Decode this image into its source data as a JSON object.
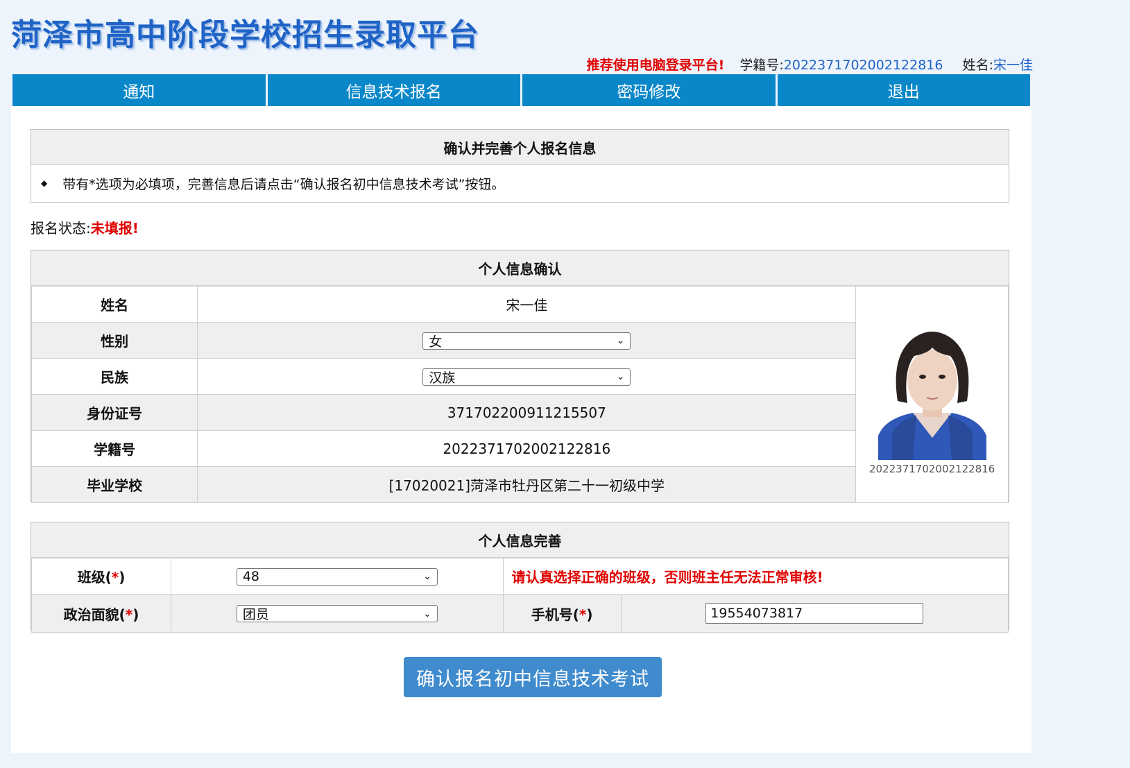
{
  "site_title": "菏泽市高中阶段学校招生录取平台",
  "user_bar": {
    "warning": "推荐使用电脑登录平台!",
    "student_id_label": "学籍号:",
    "student_id": "2022371702002122816",
    "name_label": "姓名:",
    "name": "宋一佳"
  },
  "nav": [
    "通知",
    "信息技术报名",
    "密码修改",
    "退出"
  ],
  "notice": {
    "title": "确认并完善个人报名信息",
    "text": "带有*选项为必填项，完善信息后请点击“确认报名初中信息技术考试”按钮。"
  },
  "status": {
    "label": "报名状态:",
    "value": "未填报!"
  },
  "personal_info": {
    "title": "个人信息确认",
    "rows": [
      {
        "label": "姓名",
        "value": "宋一佳"
      },
      {
        "label": "性别",
        "value": "女"
      },
      {
        "label": "民族",
        "value": "汉族"
      },
      {
        "label": "身份证号",
        "value": "371702200911215507"
      },
      {
        "label": "学籍号",
        "value": "2022371702002122816"
      },
      {
        "label": "毕业学校",
        "value": "[17020021]菏泽市牡丹区第二十一初级中学"
      }
    ],
    "photo_caption": "2022371702002122816"
  },
  "complete_info": {
    "title": "个人信息完善",
    "class_label": "班级(",
    "required_mark": "*",
    "label_close": ")",
    "class_value": "48",
    "class_hint": "请认真选择正确的班级，否则班主任无法正常审核!",
    "politics_label": "政治面貌(",
    "politics_value": "团员",
    "phone_label": "手机号(",
    "phone_value": "19554073817"
  },
  "submit_label": "确认报名初中信息技术考试",
  "colors": {
    "accent": "#0a87c9",
    "title": "#1f63c6",
    "warning": "#e00000",
    "button": "#3f8bcd"
  }
}
